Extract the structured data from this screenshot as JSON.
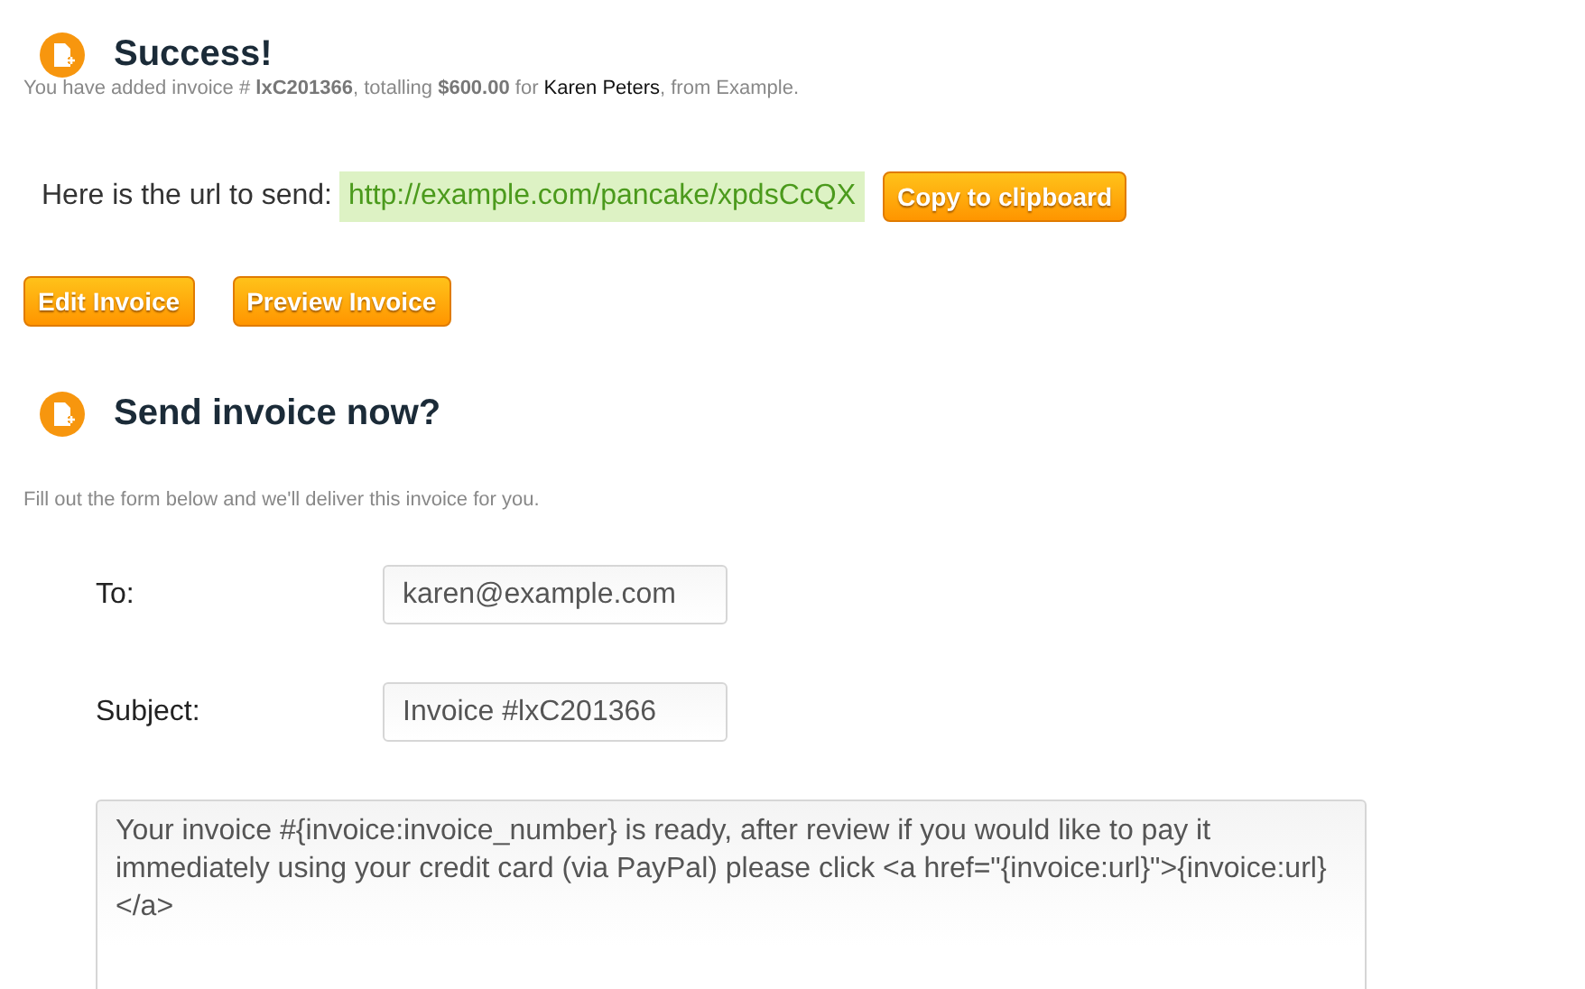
{
  "success": {
    "title": "Success!",
    "summary": {
      "before": "You have added invoice # **lxC201366**, totalling **$600.00** for ",
      "link": "Karen Peters",
      "after": ", from Example."
    },
    "url_label": "Here is the url to send:",
    "url": "http://example.com/pancake/xpdsCcQX",
    "copy_button": "Copy to clipboard",
    "buttons": [
      "Edit Invoice",
      "Preview Invoice"
    ]
  },
  "send": {
    "title": "Send invoice now?",
    "intro": "Fill out the form below and we'll deliver this invoice for you.",
    "fields": [
      {
        "label": "To:",
        "value": "karen@example.com"
      },
      {
        "label": "Subject:",
        "value": "Invoice #lxC201366"
      }
    ],
    "message": "Your invoice #{invoice:invoice_number} is ready, after review if you would like to pay it immediately using your credit card (via PayPal) please click <a href=\"{invoice:url}\">{invoice:url}</a>"
  }
}
